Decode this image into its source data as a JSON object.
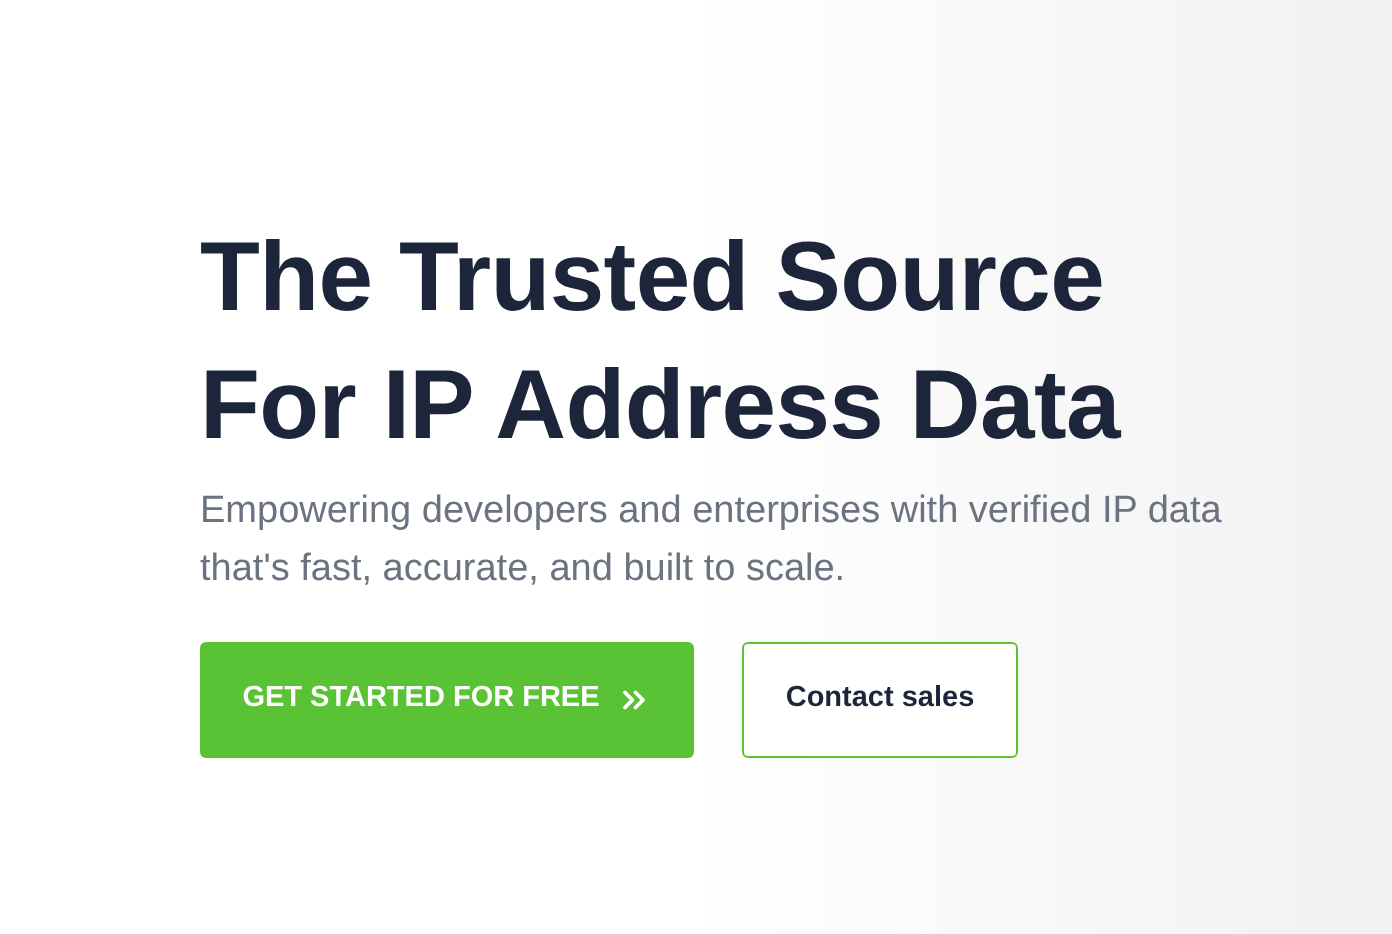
{
  "hero": {
    "title_lines": [
      "The Trusted Source",
      "For IP Address Data"
    ],
    "subtitle": "Empowering developers and enterprises with verified IP data that's fast, accurate, and built to scale.",
    "buttons": [
      {
        "kind": "primary",
        "label": "GET STARTED FOR FREE"
      },
      {
        "kind": "outline",
        "label": "Contact sales"
      }
    ]
  }
}
